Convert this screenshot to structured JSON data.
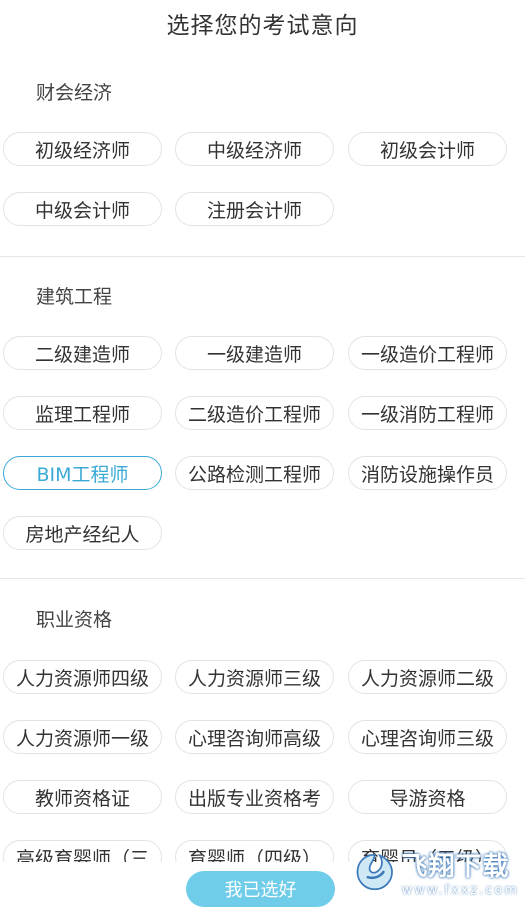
{
  "title": "选择您的考试意向",
  "sections": [
    {
      "title": "财会经济",
      "items": [
        "初级经济师",
        "中级经济师",
        "初级会计师",
        "中级会计师",
        "注册会计师"
      ]
    },
    {
      "title": "建筑工程",
      "items": [
        "二级建造师",
        "一级建造师",
        "一级造价工程师",
        "监理工程师",
        "二级造价工程师",
        "一级消防工程师",
        "BIM工程师",
        "公路检测工程师",
        "消防设施操作员",
        "房地产经纪人"
      ]
    },
    {
      "title": "职业资格",
      "items": [
        "人力资源师四级",
        "人力资源师三级",
        "人力资源师二级",
        "人力资源师一级",
        "心理咨询师高级",
        "心理咨询师三级",
        "教师资格证",
        "出版专业资格考",
        "导游资格",
        "高级育婴师（三",
        "育婴师（四级）",
        "育婴员（五级）"
      ]
    }
  ],
  "selected_item": "BIM工程师",
  "confirm_label": "我已选好",
  "watermark": {
    "cn": "飞翔下载",
    "en": "www.fxxz.com"
  },
  "colors": {
    "accent": "#3aa9d6",
    "button": "#6fcdea"
  }
}
